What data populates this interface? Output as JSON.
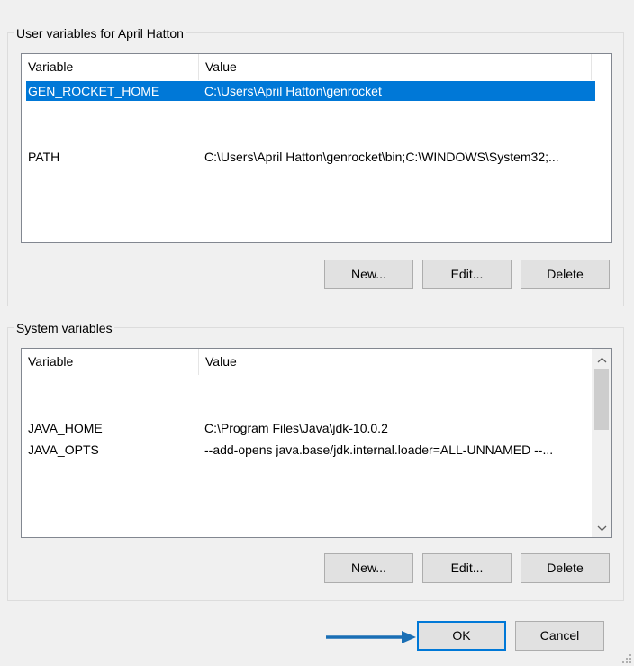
{
  "user_vars": {
    "title": "User variables for April Hatton",
    "columns": {
      "variable": "Variable",
      "value": "Value"
    },
    "rows": [
      {
        "name": "GEN_ROCKET_HOME",
        "value": "C:\\Users\\April Hatton\\genrocket",
        "selected": true
      },
      {
        "name": "PATH",
        "value": "C:\\Users\\April Hatton\\genrocket\\bin;C:\\WINDOWS\\System32;...",
        "selected": false
      }
    ],
    "buttons": {
      "new": "New...",
      "edit": "Edit...",
      "delete": "Delete"
    }
  },
  "system_vars": {
    "title": "System variables",
    "columns": {
      "variable": "Variable",
      "value": "Value"
    },
    "rows": [
      {
        "name": "JAVA_HOME",
        "value": "C:\\Program Files\\Java\\jdk-10.0.2"
      },
      {
        "name": "JAVA_OPTS",
        "value": "--add-opens java.base/jdk.internal.loader=ALL-UNNAMED --..."
      }
    ],
    "buttons": {
      "new": "New...",
      "edit": "Edit...",
      "delete": "Delete"
    }
  },
  "dialog_buttons": {
    "ok": "OK",
    "cancel": "Cancel"
  },
  "icons": {
    "scroll_up": "chevron-up-icon",
    "scroll_down": "chevron-down-icon"
  },
  "colors": {
    "selection": "#0078d7",
    "annotation_arrow": "#1a6fb5"
  }
}
